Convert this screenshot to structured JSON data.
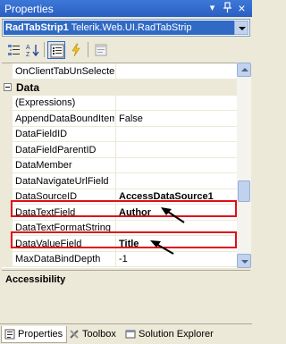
{
  "window": {
    "title": "Properties"
  },
  "title_buttons": {
    "dropdown": "▾",
    "pin": "ᛰ",
    "close": "×"
  },
  "selector": {
    "name": "RadTabStrip1",
    "type": "Telerik.Web.UI.RadTabStrip"
  },
  "toolbar": {
    "tools": [
      "categorized",
      "alphabetical",
      "properties",
      "events",
      "property-pages"
    ]
  },
  "grid": {
    "rows": [
      {
        "kind": "prop",
        "name": "OnClientTabUnSelecte",
        "value": ""
      },
      {
        "kind": "cat",
        "name": "Data"
      },
      {
        "kind": "prop",
        "name": "(Expressions)",
        "value": ""
      },
      {
        "kind": "prop",
        "name": "AppendDataBoundItem",
        "value": "False"
      },
      {
        "kind": "prop",
        "name": "DataFieldID",
        "value": ""
      },
      {
        "kind": "prop",
        "name": "DataFieldParentID",
        "value": ""
      },
      {
        "kind": "prop",
        "name": "DataMember",
        "value": ""
      },
      {
        "kind": "prop",
        "name": "DataNavigateUrlField",
        "value": ""
      },
      {
        "kind": "prop",
        "name": "DataSourceID",
        "value": "AccessDataSource1",
        "bold": true
      },
      {
        "kind": "prop",
        "name": "DataTextField",
        "value": "Author",
        "bold": true
      },
      {
        "kind": "prop",
        "name": "DataTextFormatString",
        "value": ""
      },
      {
        "kind": "prop",
        "name": "DataValueField",
        "value": "Title",
        "bold": true
      },
      {
        "kind": "prop",
        "name": "MaxDataBindDepth",
        "value": "-1"
      }
    ]
  },
  "description": {
    "title": "Accessibility"
  },
  "tabs": [
    {
      "label": "Properties",
      "active": true
    },
    {
      "label": "Toolbox",
      "active": false
    },
    {
      "label": "Solution Explorer",
      "active": false
    }
  ],
  "colors": {
    "highlight": "#e0101a",
    "selection": "#316ac5",
    "titlebar": "#2a5fc2"
  }
}
